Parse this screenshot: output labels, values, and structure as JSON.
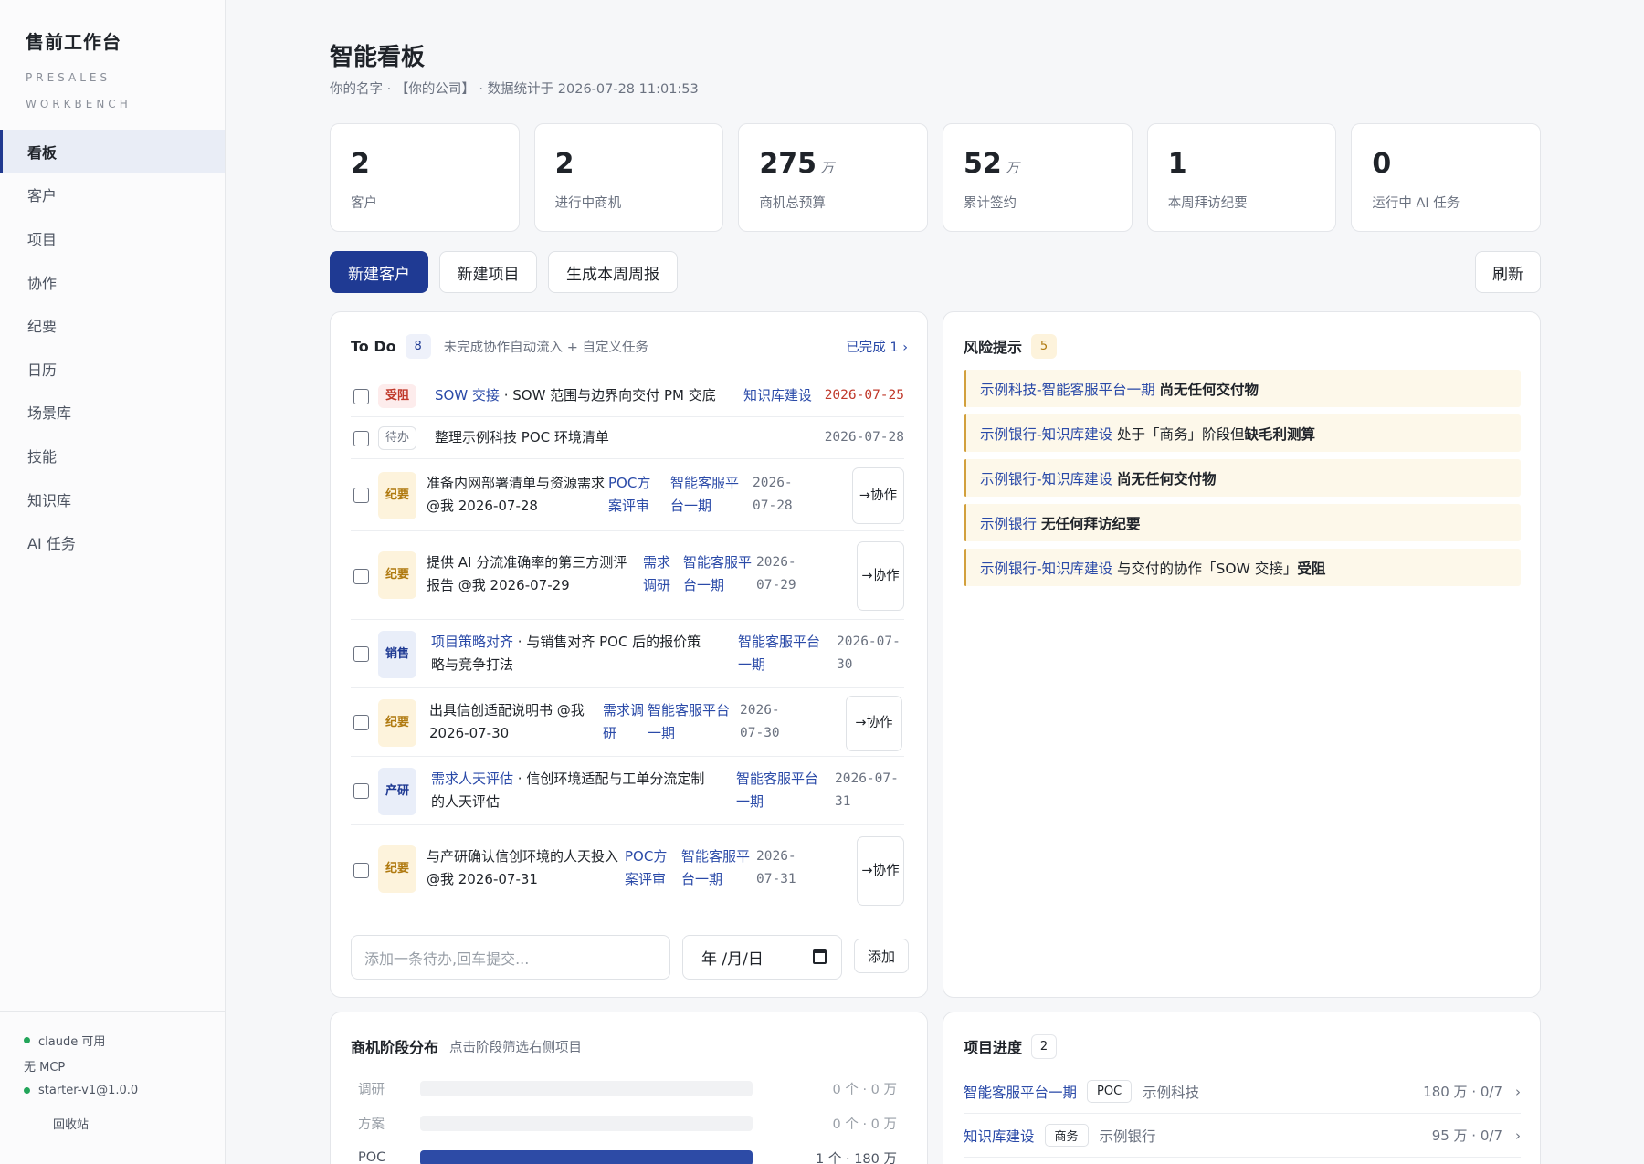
{
  "sidebar": {
    "title": "售前工作台",
    "subtitle": "PRESALES WORKBENCH",
    "nav": [
      "看板",
      "客户",
      "项目",
      "协作",
      "纪要",
      "日历",
      "场景库",
      "技能",
      "知识库",
      "AI 任务"
    ],
    "status": [
      "claude 可用",
      "无 MCP",
      "starter-v1@1.0.0"
    ],
    "recycle": "回收站"
  },
  "header": {
    "title": "智能看板",
    "meta": "你的名字 · 【你的公司】 · 数据统计于 2026-07-28 11:01:53"
  },
  "stats": [
    {
      "value": "2",
      "unit": "",
      "label": "客户"
    },
    {
      "value": "2",
      "unit": "",
      "label": "进行中商机"
    },
    {
      "value": "275",
      "unit": "万",
      "label": "商机总预算"
    },
    {
      "value": "52",
      "unit": "万",
      "label": "累计签约"
    },
    {
      "value": "1",
      "unit": "",
      "label": "本周拜访纪要"
    },
    {
      "value": "0",
      "unit": "",
      "label": "运行中 AI 任务"
    }
  ],
  "actions": {
    "new_customer": "新建客户",
    "new_project": "新建项目",
    "weekly_report": "生成本周周报",
    "refresh": "刷新"
  },
  "todo": {
    "title": "To Do",
    "count": "8",
    "subtitle": "未完成协作自动流入 + 自定义任务",
    "done_link": "已完成 1 ›",
    "items": [
      {
        "tag": "受阻",
        "link": "SOW 交接",
        "text": " · SOW 范围与边界向交付 PM 交底",
        "project": "知识库建设",
        "date": "2026-07-25"
      },
      {
        "tag": "待办",
        "text": "整理示例科技 POC 环境清单",
        "date": "2026-07-28"
      },
      {
        "tag": "纪要",
        "text": "准备内网部署清单与资源需求 @我 2026-07-28",
        "scene": "POC方案评审",
        "project": "智能客服平台一期",
        "date": "2026-07-28",
        "btn": "→协作"
      },
      {
        "tag": "纪要",
        "text": "提供 AI 分流准确率的第三方测评报告 @我 2026-07-29",
        "scene": "需求调研",
        "project": "智能客服平台一期",
        "date": "2026-07-29",
        "btn": "→协作"
      },
      {
        "tag": "销售",
        "link": "项目策略对齐",
        "text": " · 与销售对齐 POC 后的报价策略与竞争打法",
        "project": "智能客服平台一期",
        "date": "2026-07-30"
      },
      {
        "tag": "纪要",
        "text": "出具信创适配说明书 @我 2026-07-30",
        "scene": "需求调研",
        "project": "智能客服平台一期",
        "date": "2026-07-30",
        "btn": "→协作"
      },
      {
        "tag": "产研",
        "link": "需求人天评估",
        "text": " · 信创环境适配与工单分流定制的人天评估",
        "project": "智能客服平台一期",
        "date": "2026-07-31"
      },
      {
        "tag": "纪要",
        "text": "与产研确认信创环境的人天投入 @我 2026-07-31",
        "scene": "POC方案评审",
        "project": "智能客服平台一期",
        "date": "2026-07-31",
        "btn": "→协作"
      }
    ],
    "add_placeholder": "添加一条待办,回车提交...",
    "date_placeholder": "年 /月/日",
    "add_button": "添加"
  },
  "risks": {
    "title": "风险提示",
    "count": "5",
    "items": [
      {
        "link": "示例科技-智能客服平台一期",
        "text": " ",
        "bold": "尚无任何交付物"
      },
      {
        "link": "示例银行-知识库建设",
        "text": " 处于「商务」阶段但",
        "bold": "缺毛利测算"
      },
      {
        "link": "示例银行-知识库建设",
        "text": " ",
        "bold": "尚无任何交付物"
      },
      {
        "link": "示例银行",
        "text": " ",
        "bold": "无任何拜访纪要"
      },
      {
        "link": "示例银行-知识库建设",
        "text": " 与交付的协作「SOW 交接」",
        "bold": "受阻"
      }
    ]
  },
  "stages": {
    "title": "商机阶段分布",
    "subtitle": "点击阶段筛选右侧项目",
    "items": [
      {
        "name": "调研",
        "value": "0 个 · 0 万",
        "fill": 0
      },
      {
        "name": "方案",
        "value": "0 个 · 0 万",
        "fill": 0
      },
      {
        "name": "POC",
        "value": "1 个 · 180 万",
        "fill": 1
      }
    ]
  },
  "projects": {
    "title": "项目进度",
    "count": "2",
    "items": [
      {
        "name": "智能客服平台一期",
        "stage": "POC",
        "customer": "示例科技",
        "info": "180 万 · 0/7"
      },
      {
        "name": "知识库建设",
        "stage": "商务",
        "customer": "示例银行",
        "info": "95 万 · 0/7"
      }
    ]
  },
  "colors": {
    "primary": "#1f3a93",
    "risk_bg": "#fdf8ea",
    "risk_border": "#d2a03c",
    "alert": "#c0392b"
  }
}
